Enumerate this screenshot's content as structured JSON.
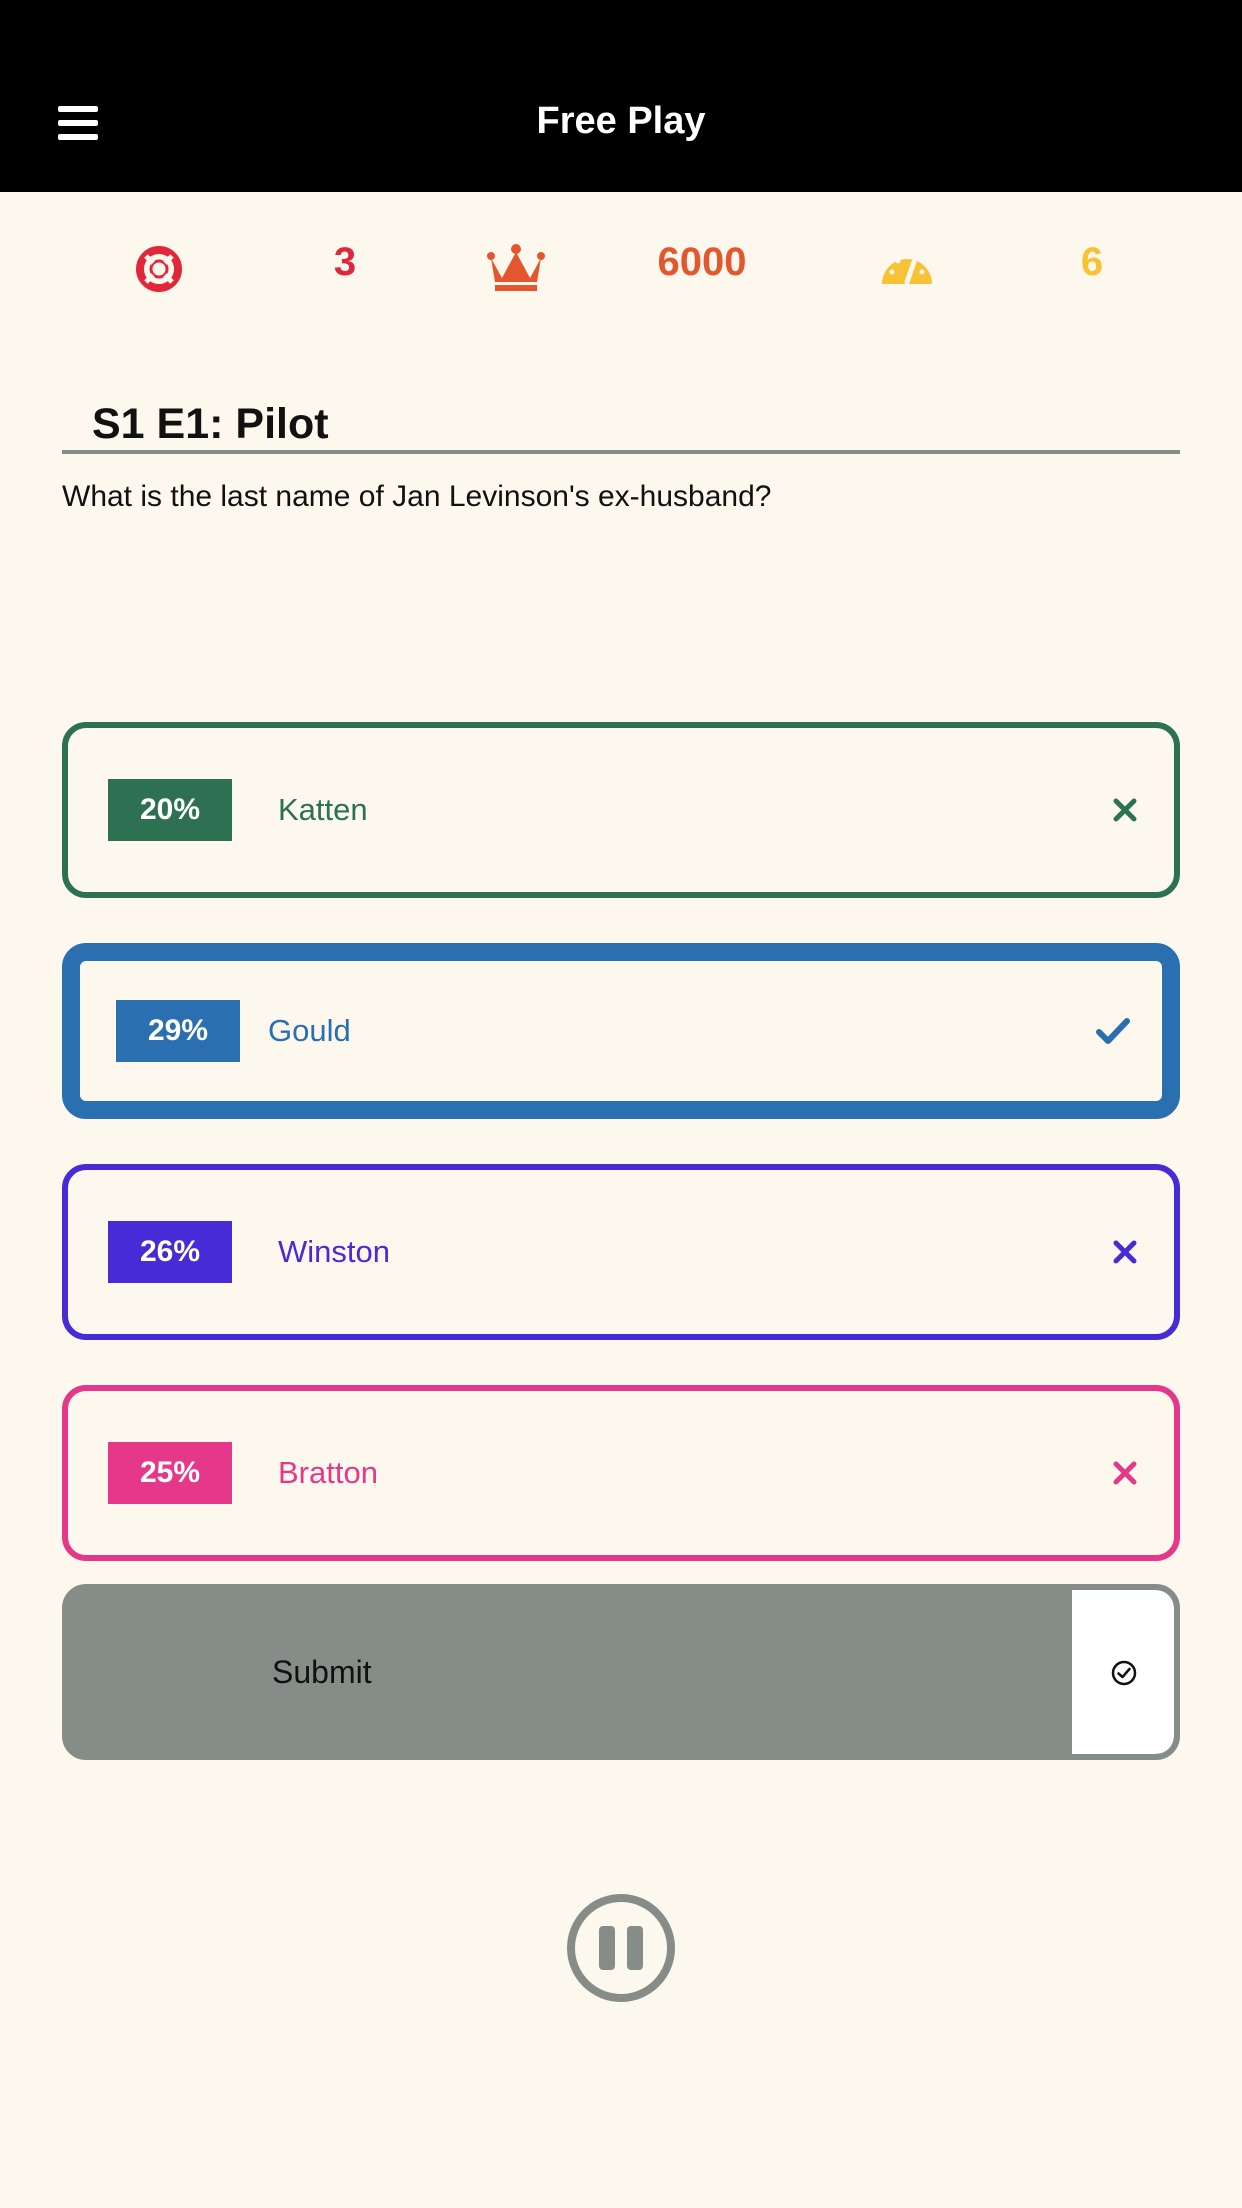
{
  "header": {
    "title": "Free Play",
    "menu_icon": "hamburger-menu-icon"
  },
  "stats": {
    "lives": {
      "icon": "lifebuoy-icon",
      "value": "3",
      "color": "#e0273b"
    },
    "score": {
      "icon": "crown-icon",
      "value": "6000",
      "color": "#e4572e"
    },
    "speed": {
      "icon": "speedometer-icon",
      "value": "6",
      "color": "#f7c234"
    }
  },
  "quiz": {
    "episode_title": "S1 E1: Pilot",
    "question": "What is the last name of Jan Levinson's ex-husband?",
    "answers": [
      {
        "label": "Katten",
        "percent": "20%",
        "color": "#2e7152",
        "mark": "cross-icon",
        "selected": false
      },
      {
        "label": "Gould",
        "percent": "29%",
        "color": "#2a6fb0",
        "mark": "checkmark-icon",
        "selected": true
      },
      {
        "label": "Winston",
        "percent": "26%",
        "color": "#472bd6",
        "mark": "cross-icon",
        "selected": false
      },
      {
        "label": "Bratton",
        "percent": "25%",
        "color": "#e5388b",
        "mark": "cross-icon",
        "selected": false
      }
    ],
    "submit_label": "Submit",
    "submit_icon": "circle-check-icon"
  },
  "controls": {
    "pause_icon": "pause-icon"
  }
}
